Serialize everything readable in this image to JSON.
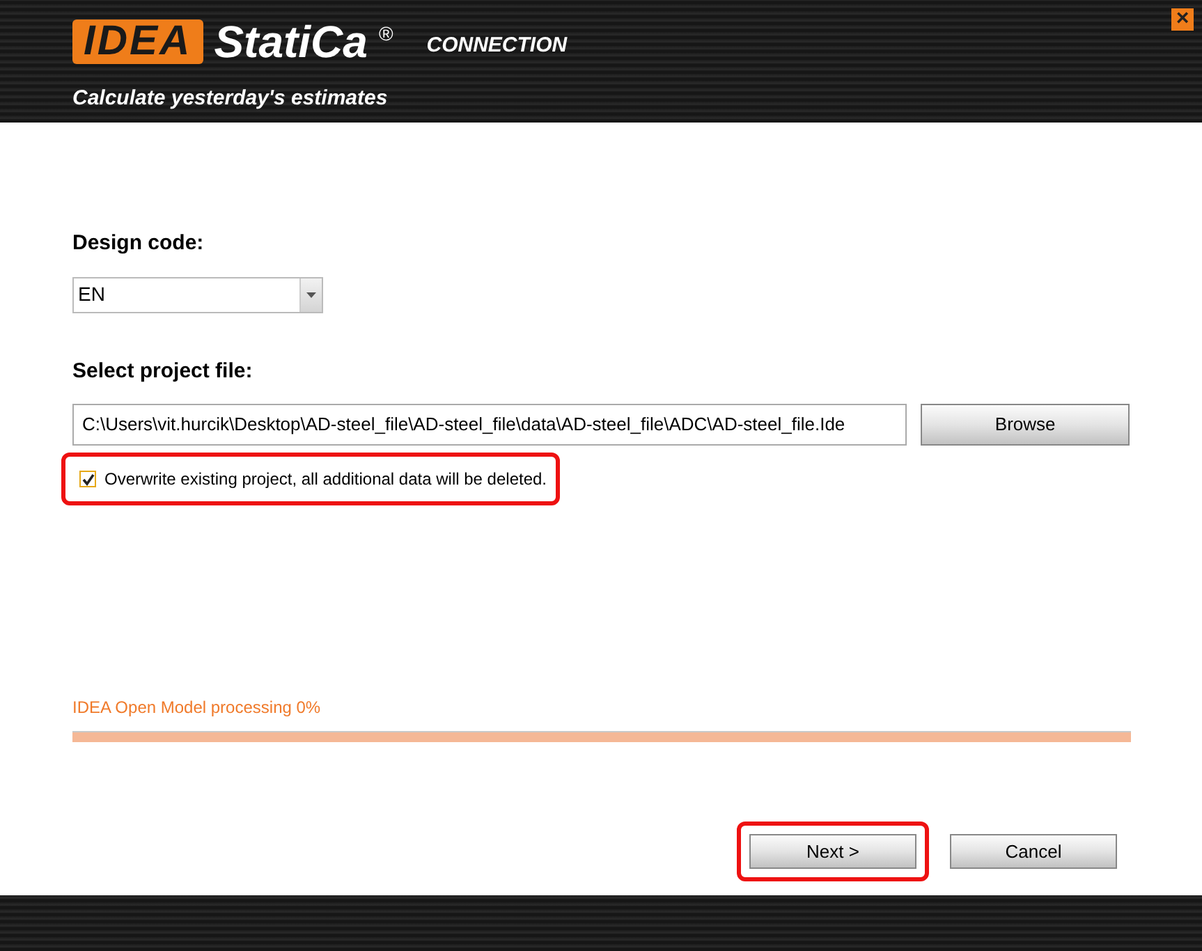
{
  "header": {
    "logo_mark": "IDEA",
    "logo_name": "StatiCa",
    "logo_registered": "®",
    "product": "CONNECTION",
    "tagline": "Calculate yesterday's estimates",
    "close": "×"
  },
  "design_code": {
    "label": "Design code:",
    "value": "EN"
  },
  "project_file": {
    "label": "Select project file:",
    "value": "C:\\Users\\vit.hurcik\\Desktop\\AD-steel_file\\AD-steel_file\\data\\AD-steel_file\\ADC\\AD-steel_file.Ide",
    "browse": "Browse"
  },
  "overwrite": {
    "label": "Overwrite existing project, all additional data will be deleted.",
    "checked": true,
    "highlighted": true
  },
  "progress": {
    "label": "IDEA Open Model processing 0%",
    "level": 0
  },
  "buttons": [
    {
      "label": "Next >",
      "highlighted": true
    },
    {
      "label": "Cancel",
      "highlighted": false
    }
  ]
}
